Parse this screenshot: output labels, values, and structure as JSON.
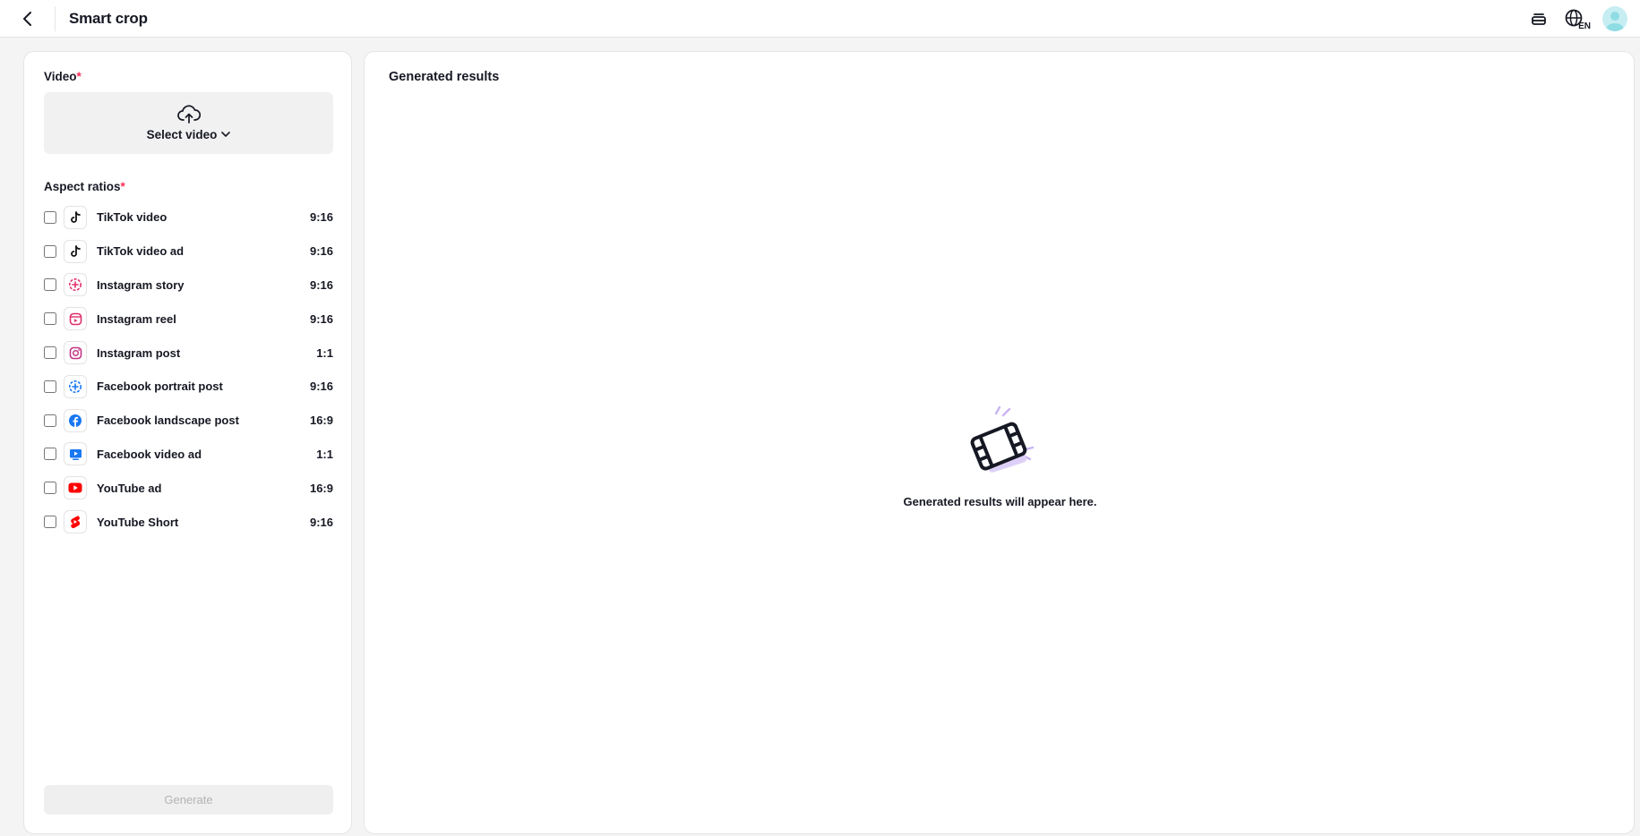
{
  "header": {
    "title": "Smart crop",
    "language_code": "EN"
  },
  "left": {
    "video_label": "Video",
    "required_mark": "*",
    "select_video_label": "Select video",
    "aspect_ratios_label": "Aspect ratios",
    "ratios": [
      {
        "name": "TikTok video",
        "ratio": "9:16",
        "icon": "tiktok-icon",
        "checked": false
      },
      {
        "name": "TikTok video ad",
        "ratio": "9:16",
        "icon": "tiktok-icon",
        "checked": false
      },
      {
        "name": "Instagram story",
        "ratio": "9:16",
        "icon": "instagram-story-icon",
        "checked": false
      },
      {
        "name": "Instagram reel",
        "ratio": "9:16",
        "icon": "instagram-reel-icon",
        "checked": false
      },
      {
        "name": "Instagram post",
        "ratio": "1:1",
        "icon": "instagram-icon",
        "checked": false
      },
      {
        "name": "Facebook portrait post",
        "ratio": "9:16",
        "icon": "facebook-story-icon",
        "checked": false
      },
      {
        "name": "Facebook landscape post",
        "ratio": "16:9",
        "icon": "facebook-icon",
        "checked": false
      },
      {
        "name": "Facebook video ad",
        "ratio": "1:1",
        "icon": "facebook-video-icon",
        "checked": false
      },
      {
        "name": "YouTube ad",
        "ratio": "16:9",
        "icon": "youtube-icon",
        "checked": false
      },
      {
        "name": "YouTube Short",
        "ratio": "9:16",
        "icon": "youtube-shorts-icon",
        "checked": false
      }
    ],
    "generate_label": "Generate"
  },
  "right": {
    "title": "Generated results",
    "empty_text": "Generated results will appear here."
  },
  "colors": {
    "required": "#fe2c55",
    "tiktok": "#000000",
    "instagram": "#e1306c",
    "facebook": "#1877f2",
    "youtube": "#ff0000",
    "illustration_accent": "#c9b4f5"
  }
}
